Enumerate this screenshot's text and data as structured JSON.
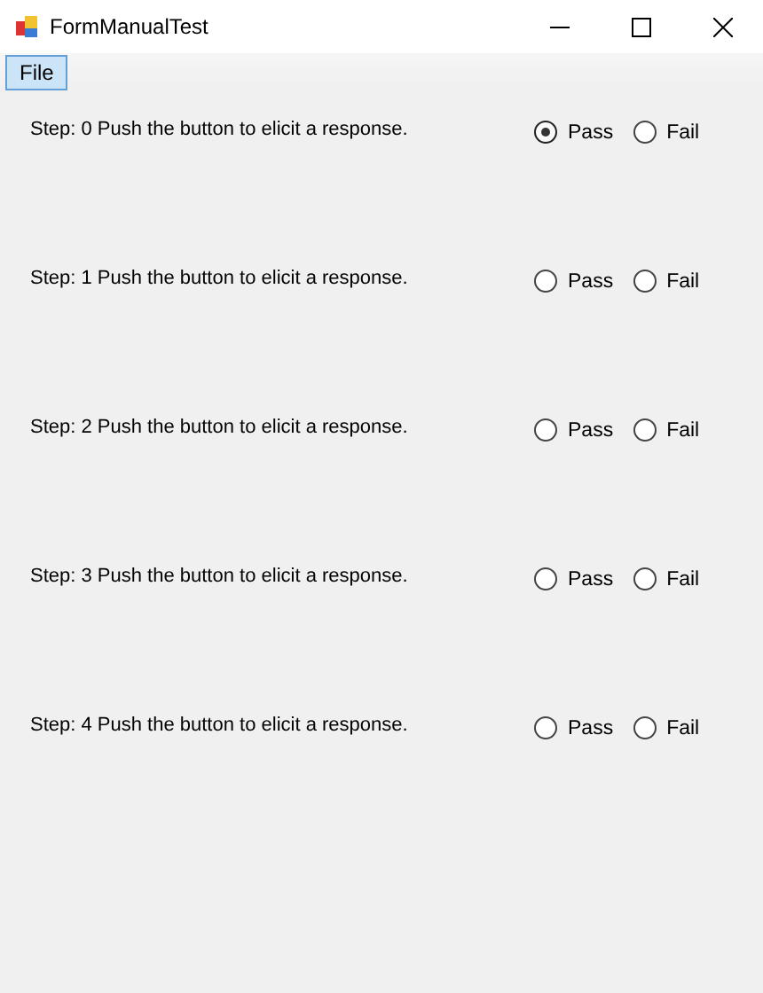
{
  "window": {
    "title": "FormManualTest"
  },
  "menu": [
    {
      "label": "File",
      "selected": true
    }
  ],
  "steps": [
    {
      "text": "Step: 0 Push the button to elicit a response.",
      "options": [
        {
          "label": "Pass",
          "selected": true
        },
        {
          "label": "Fail",
          "selected": false
        }
      ]
    },
    {
      "text": "Step: 1 Push the button to elicit a response.",
      "options": [
        {
          "label": "Pass",
          "selected": false
        },
        {
          "label": "Fail",
          "selected": false
        }
      ]
    },
    {
      "text": "Step: 2 Push the button to elicit a response.",
      "options": [
        {
          "label": "Pass",
          "selected": false
        },
        {
          "label": "Fail",
          "selected": false
        }
      ]
    },
    {
      "text": "Step: 3 Push the button to elicit a response.",
      "options": [
        {
          "label": "Pass",
          "selected": false
        },
        {
          "label": "Fail",
          "selected": false
        }
      ]
    },
    {
      "text": "Step: 4 Push the button to elicit a response.",
      "options": [
        {
          "label": "Pass",
          "selected": false
        },
        {
          "label": "Fail",
          "selected": false
        }
      ]
    }
  ]
}
